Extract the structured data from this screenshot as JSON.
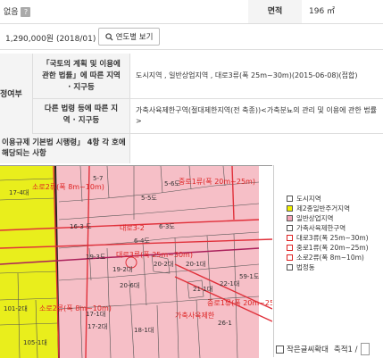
{
  "top": {
    "left_value": "없음",
    "right_label": "면적",
    "right_value": "196 ㎡"
  },
  "price": {
    "value": "1,290,000원 (2018/01)",
    "yearly_button": "연도별 보기"
  },
  "zoning": {
    "side_label": "정여부",
    "row1_label": "「국토의 계획 및 이용에 관한 법률」에 따른 지역 · 지구등",
    "row1_value": "도시지역 , 일반상업지역 , 대로3류(폭 25m~30m)(2015-06-08)(접합)",
    "row2_label": "다른 법령 등에 따른 지역 · 지구등",
    "row2_value": "가축사육제한구역(절대제한지역(전 축종))<가축분뇨의 관리 및 이용에 관한 법률>",
    "row3_label": "이용규제 기본법 시행령」 4항 각 호에 해당되는 사항"
  },
  "map": {
    "road_labels": [
      "소로2류(폭 8m~10m)",
      "중로1류(폭 20m~25m)",
      "대로3-2",
      "대로3류(폭 25m~30m)",
      "중로1류(폭 20m~25m)",
      "가축사육제한",
      "소로2류(폭 8m~10m)"
    ],
    "parcel_labels": [
      "17-4대",
      "5-6도",
      "5-5도",
      "5-7",
      "16-3 도",
      "6-3도",
      "6-4도",
      "19-3도",
      "19-2대",
      "20-2대",
      "20-1대",
      "20-6대",
      "21-1대",
      "22-1대",
      "59-1도",
      "17-1대",
      "17-2대",
      "18-1대",
      "101-2대",
      "105-1대",
      "26-1"
    ]
  },
  "legend": {
    "items": [
      {
        "label": "도시지역",
        "color": "#ffffff",
        "kind": "box"
      },
      {
        "label": "제2종일반주거지역",
        "color": "#f2f200",
        "kind": "box"
      },
      {
        "label": "일반상업지역",
        "color": "#f4a6b8",
        "kind": "box"
      },
      {
        "label": "가축사육제한구역",
        "color": "#ffffff",
        "kind": "box"
      },
      {
        "label": "대로3류(폭 25m~30m)",
        "color": "#d22222",
        "kind": "box"
      },
      {
        "label": "중로1류(폭 20m~25m)",
        "color": "#d22222",
        "kind": "box"
      },
      {
        "label": "소로2류(폭 8m~10m)",
        "color": "#d22222",
        "kind": "box"
      },
      {
        "label": "법정동",
        "color": "#ffffff",
        "kind": "box"
      }
    ],
    "small_letter_label": "작은글씨확대",
    "scale_label": "축적1 /"
  }
}
